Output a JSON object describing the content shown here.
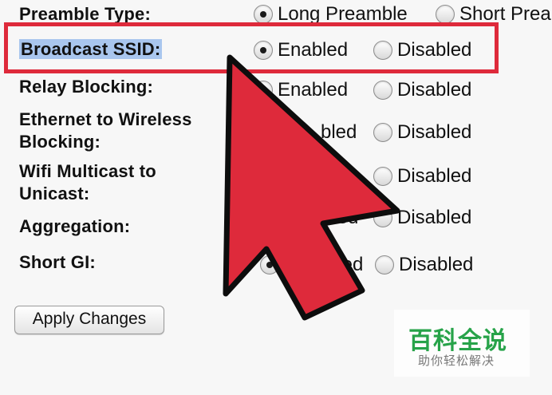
{
  "settings": [
    {
      "label": "Preamble Type:",
      "options": [
        "Long Preamble",
        "Short Prea"
      ],
      "selected": 0
    },
    {
      "label": "Broadcast SSID:",
      "options": [
        "Enabled",
        "Disabled"
      ],
      "selected": 0
    },
    {
      "label": "Relay Blocking:",
      "options": [
        "Enabled",
        "Disabled"
      ],
      "selected": 0
    },
    {
      "label_line1": "Ethernet to Wireless",
      "label_line2": "Blocking:",
      "options": [
        "Enabled",
        "Disabled"
      ],
      "selected": 0,
      "visible_enabled_text": "bled"
    },
    {
      "label_line1": "Wifi Multicast to",
      "label_line2": "Unicast:",
      "options": [
        "Disabled"
      ]
    },
    {
      "label": "Aggregation:",
      "options": [
        "bled",
        "Disabled"
      ]
    },
    {
      "label": "Short GI:",
      "options": [
        "En",
        "bled",
        "Disabled"
      ],
      "selected": 0
    }
  ],
  "apply_button": "Apply Changes",
  "annotation": {
    "highlight_color": "#de2a3b",
    "icon": "arrow-pointer-icon"
  },
  "watermark": {
    "title": "百科全说",
    "subtitle": "助你轻松解决",
    "color": "#27a349"
  }
}
